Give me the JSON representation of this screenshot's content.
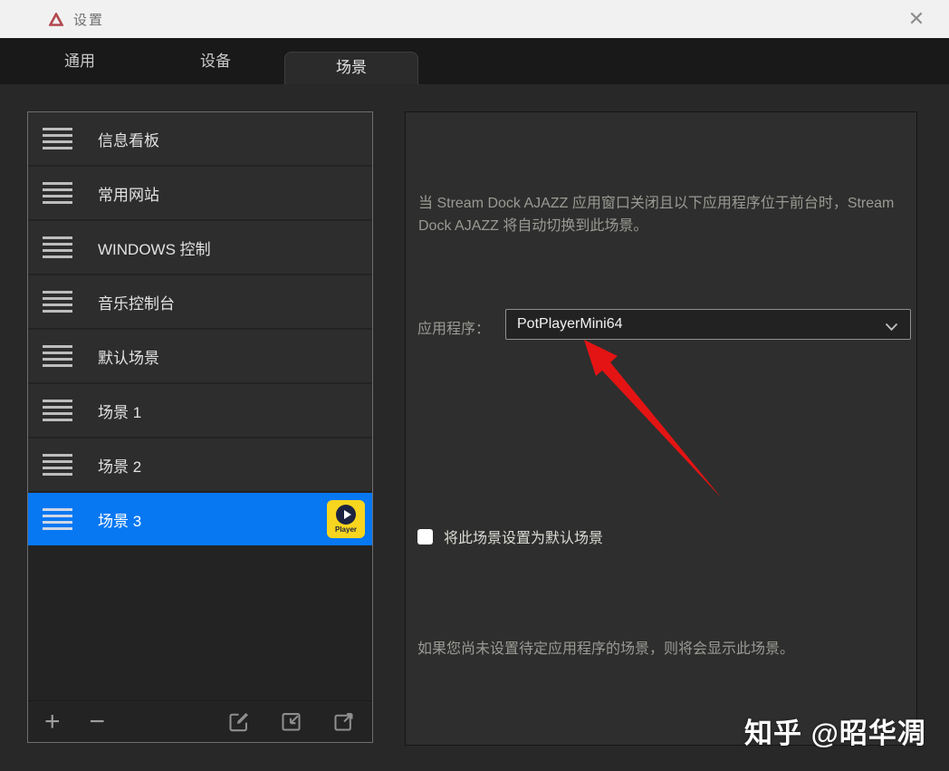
{
  "window": {
    "title": "设置",
    "close_glyph": "✕"
  },
  "tabs": {
    "items": [
      {
        "label": "通用"
      },
      {
        "label": "设备"
      },
      {
        "label": "场景"
      }
    ],
    "active_label": "场景"
  },
  "scene_list": {
    "items": [
      {
        "label": "信息看板"
      },
      {
        "label": "常用网站"
      },
      {
        "label": "WINDOWS 控制"
      },
      {
        "label": "音乐控制台"
      },
      {
        "label": "默认场景"
      },
      {
        "label": "场景 1"
      },
      {
        "label": "场景 2"
      },
      {
        "label": "场景 3"
      }
    ],
    "selected_index": 7,
    "selected_app_icon_label": "Player"
  },
  "list_toolbar": {
    "add_label": "+",
    "remove_label": "−",
    "icons": [
      "rename-icon",
      "import-icon",
      "export-icon"
    ]
  },
  "detail": {
    "auto_switch_description": "当 Stream Dock AJAZZ 应用窗口关闭且以下应用程序位于前台时，Stream Dock AJAZZ 将自动切换到此场景。",
    "app_label": "应用程序：",
    "app_selected_value": "PotPlayerMini64",
    "set_default_label": "将此场景设置为默认场景",
    "set_default_checked": false,
    "fallback_hint": "如果您尚未设置待定应用程序的场景，则将会显示此场景。"
  },
  "watermark": "知乎 @昭华凋",
  "colors": {
    "selection_blue": "#0778f2",
    "arrow_red": "#e41414",
    "potplayer_yellow": "#f8d51e",
    "titlebar_bg": "#f1f1f1",
    "tabbar_bg": "#191919",
    "panel_bg": "#2e2e2e"
  }
}
